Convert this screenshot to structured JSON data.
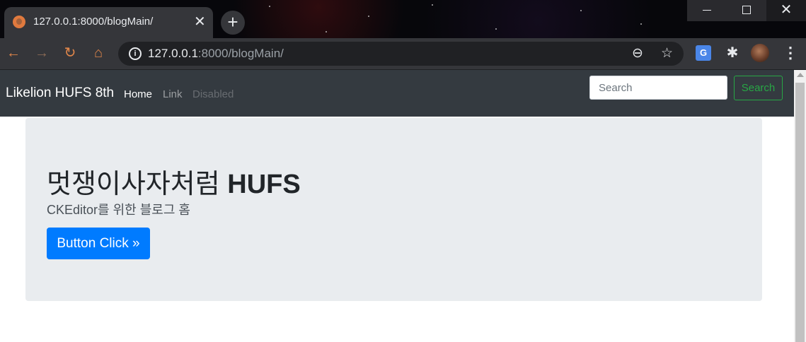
{
  "browser": {
    "tab_title": "127.0.0.1:8000/blogMain/",
    "tab_close": "✕",
    "new_tab": "+",
    "url_host": "127.0.0.1",
    "url_rest": ":8000/blogMain/",
    "icons": {
      "back": "←",
      "forward": "→",
      "reload": "↻",
      "home": "⌂",
      "zoom": "⊖",
      "star": "☆",
      "translate": "G",
      "extensions": "✱",
      "menu": "⋮",
      "info": "i"
    },
    "window_close": "✕"
  },
  "navbar": {
    "brand": "Likelion HUFS 8th",
    "links": [
      "Home",
      "Link",
      "Disabled"
    ],
    "search_placeholder": "Search",
    "search_button": "Search"
  },
  "jumbotron": {
    "heading_korean": "멋쟁이사자처럼",
    "heading_bold": "HUFS",
    "subtitle": "CKEditor를 위한 블로그 홈",
    "button": "Button Click »"
  },
  "colors": {
    "navbar_bg": "#343a40",
    "jumbotron_bg": "#e9ecef",
    "primary": "#007bff",
    "success": "#28a745",
    "chrome_toolbar": "#35363a"
  }
}
